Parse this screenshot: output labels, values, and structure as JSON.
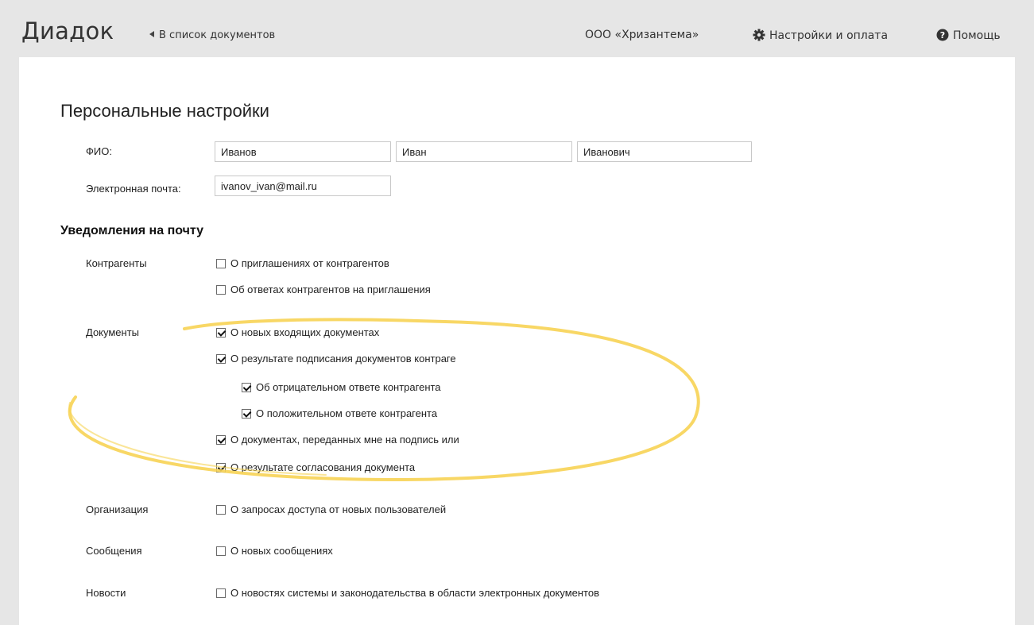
{
  "header": {
    "logo": "Диадок",
    "back_link": "В список документов",
    "organization": "ООО «Хризантема»",
    "settings_link": "Настройки и оплата",
    "help_link": "Помощь"
  },
  "page": {
    "title": "Персональные настройки"
  },
  "profile": {
    "fio_label": "ФИО:",
    "last_name": "Иванов",
    "first_name": "Иван",
    "middle_name": "Иванович",
    "email_label": "Электронная почта:",
    "email": "ivanov_ivan@mail.ru"
  },
  "notifications": {
    "title": "Уведомления на почту",
    "groups": [
      {
        "label": "Контрагенты",
        "items": [
          {
            "text": "О приглашениях от контрагентов",
            "checked": false
          },
          {
            "text": "Об ответах контрагентов на приглашения",
            "checked": false
          }
        ]
      },
      {
        "label": "Документы",
        "items": [
          {
            "text": "О новых входящих документах",
            "checked": true
          },
          {
            "text": "О результате подписания документов контраге",
            "checked": true
          },
          {
            "text": "Об отрицательном ответе контрагента",
            "checked": true
          },
          {
            "text": "О положительном ответе контрагента",
            "checked": true
          },
          {
            "text": "О документах, переданных мне на подпись или",
            "checked": true
          },
          {
            "text": "О результате согласования документа",
            "checked": true
          }
        ]
      },
      {
        "label": "Организация",
        "items": [
          {
            "text": "О запросах доступа от новых пользователей",
            "checked": false
          }
        ]
      },
      {
        "label": "Сообщения",
        "items": [
          {
            "text": "О новых сообщениях",
            "checked": false
          }
        ]
      },
      {
        "label": "Новости",
        "items": [
          {
            "text": "О новостях системы и законодательства в области электронных документов",
            "checked": false
          }
        ]
      }
    ]
  },
  "colors": {
    "highlight": "#f7d354",
    "background": "#e6e6e6",
    "panel": "#ffffff"
  }
}
